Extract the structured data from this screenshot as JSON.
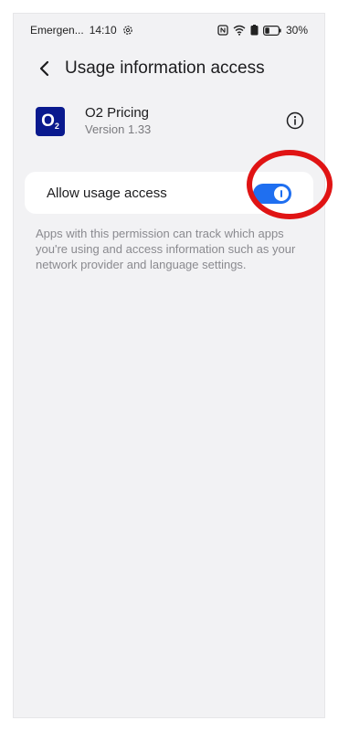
{
  "status_bar": {
    "carrier": "Emergen...",
    "time": "14:10",
    "battery": "30%",
    "icons": [
      "settings-icon",
      "nfc-icon",
      "wifi-icon",
      "battery-saver-icon",
      "battery-icon"
    ]
  },
  "header": {
    "back_icon": "chevron-left-icon",
    "title": "Usage information access"
  },
  "app": {
    "icon_text": "O",
    "icon_sub": "2",
    "icon_color": "#0a1a8e",
    "name": "O2 Pricing",
    "version": "Version 1.33",
    "info_icon": "info-icon"
  },
  "setting": {
    "label": "Allow usage access",
    "enabled": true,
    "toggle_color": "#1f6ff0"
  },
  "description": "Apps with this permission can track which apps you're using and access information such as your network provider and language settings.",
  "annotation": {
    "highlight_color": "#e01414"
  }
}
